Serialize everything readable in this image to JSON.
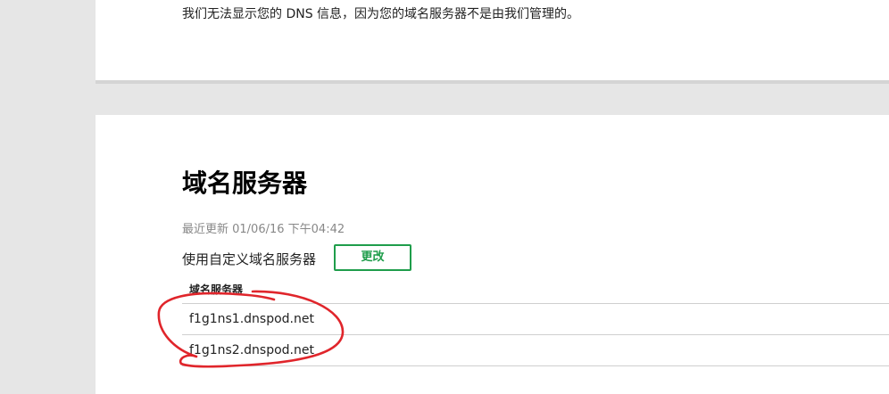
{
  "dns_panel": {
    "info_text": "我们无法显示您的 DNS 信息，因为您的域名服务器不是由我们管理的。"
  },
  "nameserver_panel": {
    "title": "域名服务器",
    "last_updated": "最近更新 01/06/16 下午04:42",
    "status": "使用自定义域名服务器",
    "change_button": "更改",
    "table": {
      "header": "域名服务器",
      "rows": [
        "f1g1ns1.dnspod.net",
        "f1g1ns2.dnspod.net"
      ]
    }
  },
  "annotation": {
    "color": "#e0252b"
  }
}
